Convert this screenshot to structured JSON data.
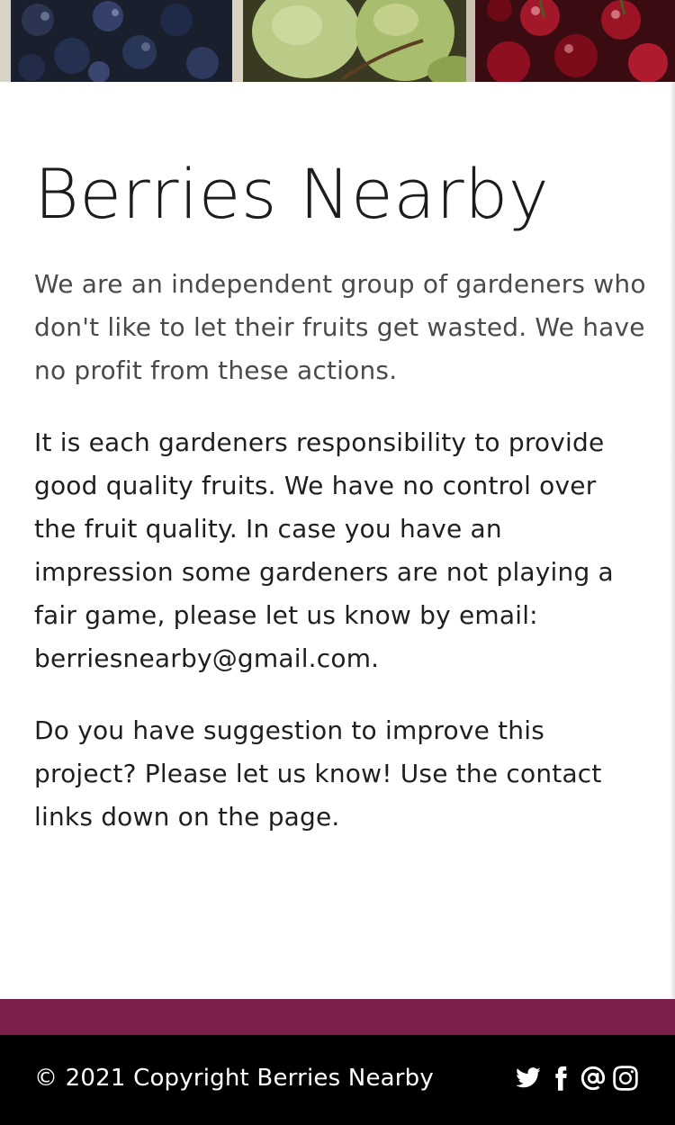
{
  "page": {
    "title": "Berries Nearby",
    "paragraphs": [
      "We are an independent group of gardeners who don't like to let their fruits get wasted. We have no profit from these actions.",
      "It is each gardeners responsibility to provide good quality fruits. We have no control over the fruit quality. In case you have an impression some gardeners are not playing a fair game, please let us know by email: berriesnearby@gmail.com.",
      "Do you have suggestion to improve this project? Please let us know! Use the contact links down on the page."
    ]
  },
  "footer": {
    "copyright": "© 2021 Copyright Berries Nearby",
    "social_icons": [
      "twitter-icon",
      "facebook-icon",
      "email-at-icon",
      "instagram-icon"
    ]
  },
  "colors": {
    "accent_bar": "#7b1f4b",
    "footer_bg": "#000000",
    "text": "#1f1f1f",
    "muted_text": "#4a4a4a"
  }
}
